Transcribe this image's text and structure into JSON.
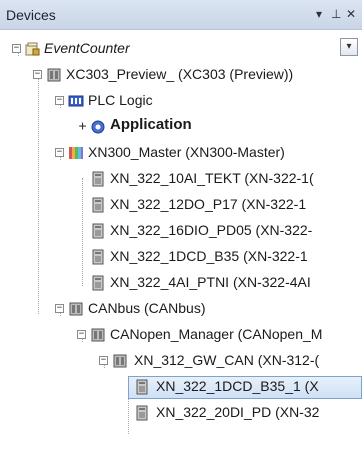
{
  "panel": {
    "title": "Devices",
    "pin_glyph": "▾",
    "dock_glyph": "⊥",
    "close_glyph": "✕",
    "dropdown_glyph": "▾"
  },
  "tree": {
    "nodes": [
      {
        "label": "EventCounter",
        "icon": "project-icon",
        "expanded": true
      },
      {
        "label": "XC303_Preview_ (XC303 (Preview))",
        "icon": "device-icon",
        "expanded": true
      },
      {
        "label": "PLC Logic",
        "icon": "plc-logic-icon",
        "expanded": true
      },
      {
        "label": "Application",
        "icon": "application-gear-icon",
        "expanded": false
      },
      {
        "label": "XN300_Master (XN300-Master)",
        "icon": "io-master-icon",
        "expanded": true
      },
      {
        "label": "XN_322_10AI_TEKT (XN-322-1(",
        "icon": "io-module-icon"
      },
      {
        "label": "XN_322_12DO_P17 (XN-322-1",
        "icon": "io-module-icon"
      },
      {
        "label": "XN_322_16DIO_PD05 (XN-322-",
        "icon": "io-module-icon"
      },
      {
        "label": "XN_322_1DCD_B35 (XN-322-1",
        "icon": "io-module-icon"
      },
      {
        "label": "XN_322_4AI_PTNI (XN-322-4AI",
        "icon": "io-module-icon"
      },
      {
        "label": "CANbus (CANbus)",
        "icon": "bus-icon",
        "expanded": true
      },
      {
        "label": "CANopen_Manager (CANopen_M",
        "icon": "bus-icon",
        "expanded": true
      },
      {
        "label": "XN_312_GW_CAN (XN-312-(",
        "icon": "gateway-icon",
        "expanded": true,
        "selected": true
      },
      {
        "label": "XN_322_1DCD_B35_1 (X",
        "icon": "io-module-icon"
      },
      {
        "label": "XN_322_20DI_PD (XN-32",
        "icon": "io-module-icon"
      }
    ]
  },
  "colors": {
    "selection_border": "#7da2ce",
    "title_bar": "#c9d5e7"
  }
}
